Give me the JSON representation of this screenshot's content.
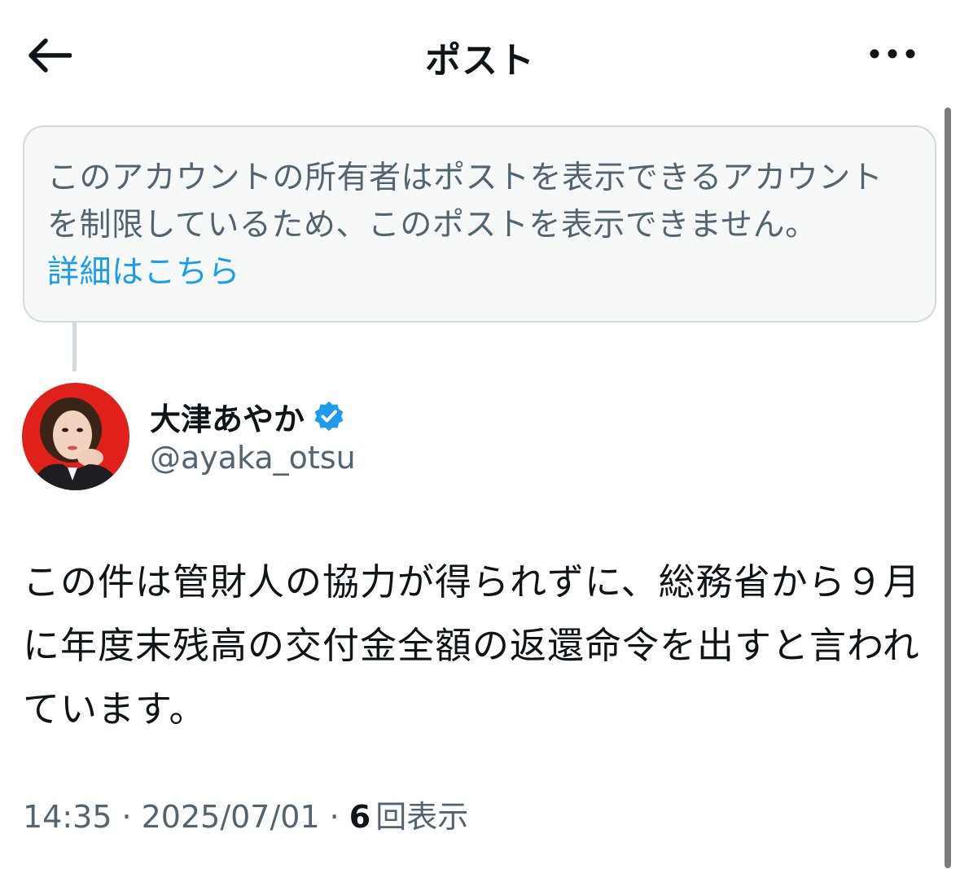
{
  "header": {
    "title": "ポスト",
    "back_icon": "arrow-left-icon",
    "more_icon": "ellipsis-icon"
  },
  "notice": {
    "text": "このアカウントの所有者はポストを表示できるアカウントを制限しているため、このポストを表示できません。",
    "link": "詳細はこちら"
  },
  "author": {
    "name": "大津あやか",
    "handle": "@ayaka_otsu",
    "verified": true,
    "verified_icon": "verified-badge-icon"
  },
  "post": {
    "text": "この件は管財人の協力が得られずに、総務省から９月に年度末残高の交付金全額の返還命令を出すと言われています。"
  },
  "meta": {
    "time": "14:35",
    "date": "2025/07/01",
    "view_count": "6",
    "view_label": "回表示",
    "separator": "·"
  },
  "colors": {
    "accent": "#1d9bf0",
    "text_primary": "#0f1419",
    "text_secondary": "#536471",
    "notice_bg": "#f7f9f9",
    "border": "#cfd9de",
    "avatar_bg": "#e0201b"
  }
}
